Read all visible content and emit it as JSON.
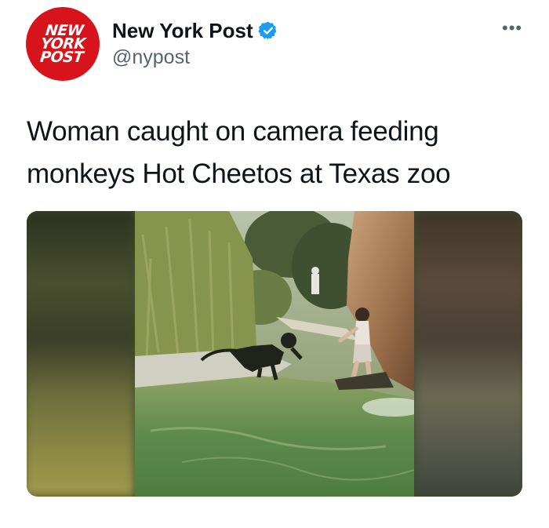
{
  "tweet": {
    "author": {
      "logo_text": "NEW\nYORK\nPOST",
      "display_name": "New York Post",
      "handle": "@nypost",
      "verified": true
    },
    "text": "Woman caught on camera feeding monkeys Hot Cheetos at Texas zoo",
    "more_icon": "ellipsis-icon",
    "media": {
      "type": "video-still"
    }
  },
  "colors": {
    "brand_red": "#d7141b",
    "verified_blue": "#1d9bf0",
    "secondary_text": "#536471",
    "primary_text": "#0f1419"
  }
}
